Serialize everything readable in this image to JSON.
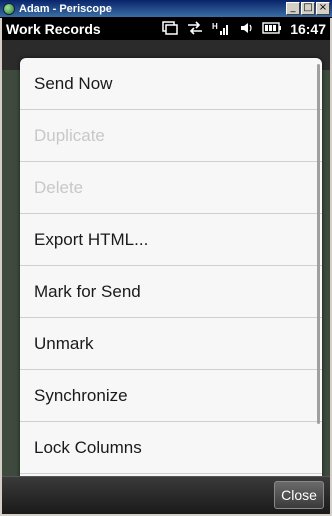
{
  "window": {
    "title": "Adam - Periscope",
    "minimize_label": "_",
    "restore_label": "□",
    "close_label": "×"
  },
  "statusbar": {
    "title": "Work Records",
    "icons": [
      "window-icon",
      "sync-icon",
      "signal-icon",
      "volume-icon",
      "battery-icon"
    ],
    "signal_label": "H",
    "time": "16:47"
  },
  "menu": {
    "items": [
      {
        "label": "Send Now",
        "enabled": true
      },
      {
        "label": "Duplicate",
        "enabled": false
      },
      {
        "label": "Delete",
        "enabled": false
      },
      {
        "label": "Export HTML...",
        "enabled": true
      },
      {
        "label": "Mark for Send",
        "enabled": true
      },
      {
        "label": "Unmark",
        "enabled": true
      },
      {
        "label": "Synchronize",
        "enabled": true
      },
      {
        "label": "Lock Columns",
        "enabled": true
      }
    ]
  },
  "softbar": {
    "close_label": "Close"
  }
}
